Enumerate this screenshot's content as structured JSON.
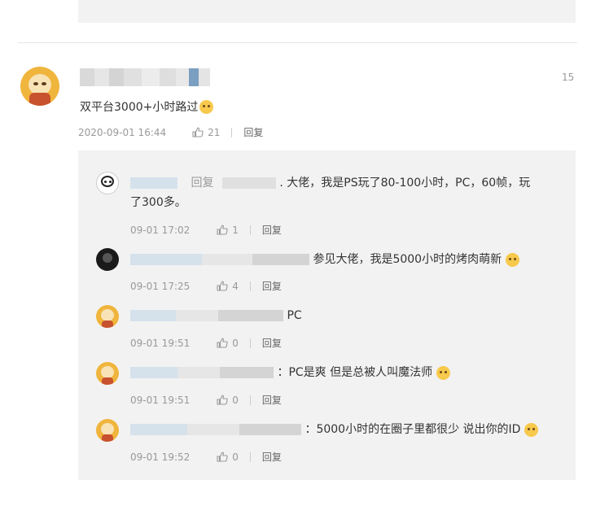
{
  "main_comment": {
    "floor": "15",
    "text": "双平台3000+小时路过",
    "time": "2020-09-01 16:44",
    "likes": "21",
    "reply_label": "回复"
  },
  "replies": [
    {
      "prefix": "回复",
      "text1": ". 大佬，我是PS玩了80-100小时，PC，60帧，玩",
      "text2": "了300多。",
      "time": "09-01 17:02",
      "likes": "1",
      "reply_label": "回复"
    },
    {
      "text": "参见大佬，我是5000小时的烤肉萌新",
      "time": "09-01 17:25",
      "likes": "4",
      "reply_label": "回复"
    },
    {
      "text": "PC",
      "time": "09-01 19:51",
      "likes": "0",
      "reply_label": "回复"
    },
    {
      "text": "：PC是爽 但是总被人叫魔法师",
      "time": "09-01 19:51",
      "likes": "0",
      "reply_label": "回复"
    },
    {
      "text": "：5000小时的在圈子里都很少 说出你的ID",
      "time": "09-01 19:52",
      "likes": "0",
      "reply_label": "回复"
    }
  ],
  "colors": {
    "panel_bg": "#f2f2f2",
    "text": "#333333",
    "meta": "#999999",
    "avatar_orange": "#f0b53c"
  },
  "icons": [
    "thumb-up-icon",
    "cat-emoji-icon"
  ]
}
